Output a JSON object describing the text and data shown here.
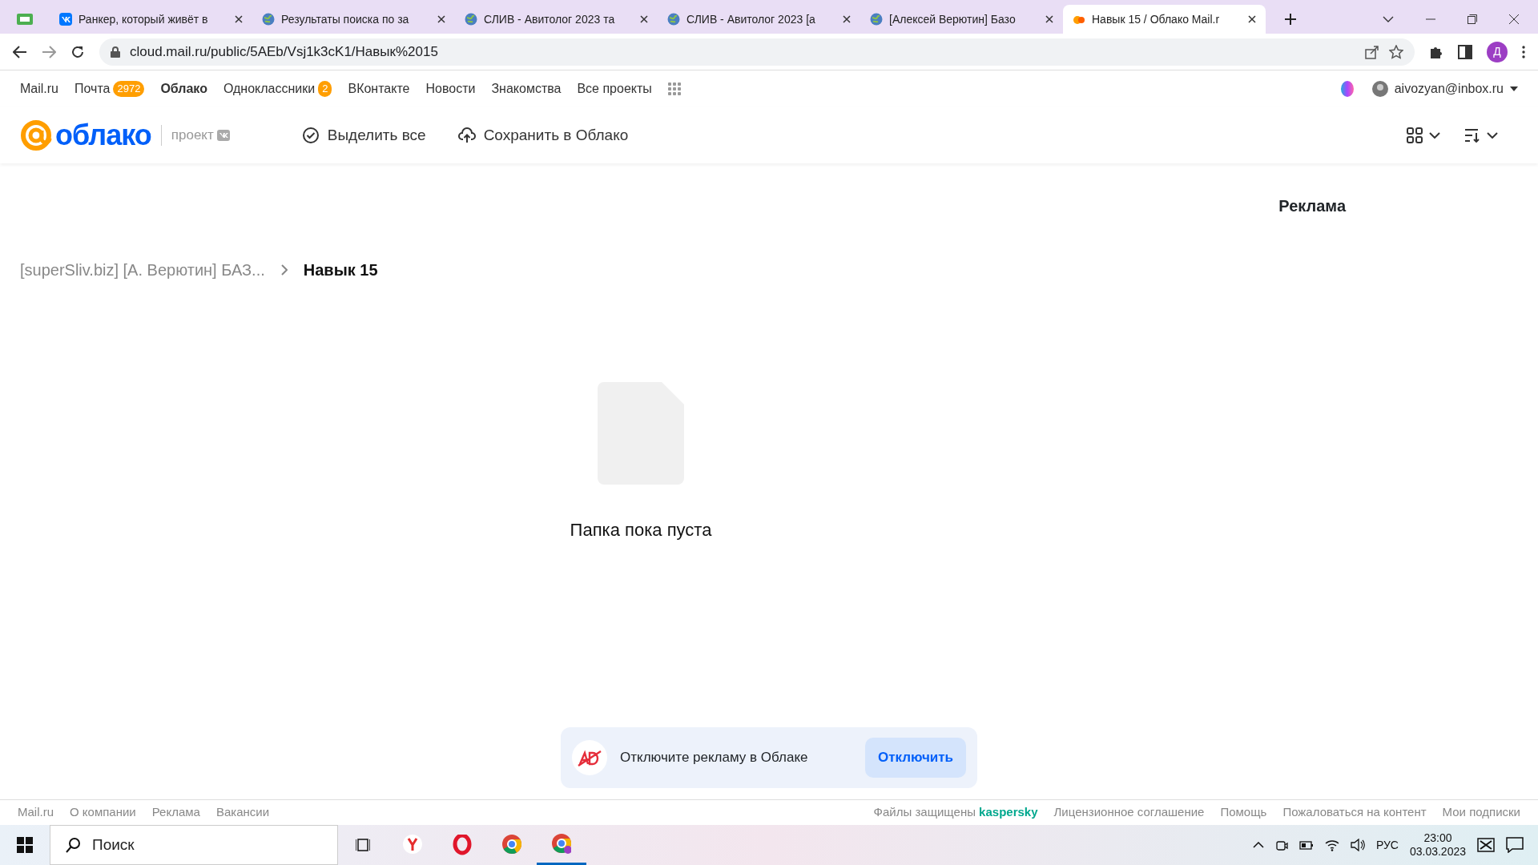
{
  "browser": {
    "tabs": [
      {
        "title": "Ранкер, который живёт в",
        "kind": "vk",
        "selected": false
      },
      {
        "title": "Результаты поиска по за",
        "kind": "globe",
        "selected": false
      },
      {
        "title": "СЛИВ - Авитолог 2023 та",
        "kind": "globe",
        "selected": false
      },
      {
        "title": "СЛИВ - Авитолог 2023 [а",
        "kind": "globe",
        "selected": false
      },
      {
        "title": "[Алексей Верютин] Базо",
        "kind": "globe",
        "selected": false
      },
      {
        "title": "Навык 15 / Облако Mail.r",
        "kind": "cloud",
        "selected": true
      }
    ],
    "url": "cloud.mail.ru/public/5AEb/Vsj1k3cK1/Навык%2015",
    "profile": "Д"
  },
  "top_nav": {
    "items": [
      {
        "label": "Mail.ru",
        "selected": false
      },
      {
        "label": "Почта",
        "badge": "2972",
        "selected": false
      },
      {
        "label": "Облако",
        "selected": true
      },
      {
        "label": "Одноклассники",
        "badge": "2",
        "selected": false
      },
      {
        "label": "ВКонтакте",
        "selected": false
      },
      {
        "label": "Новости",
        "selected": false
      },
      {
        "label": "Знакомства",
        "selected": false
      },
      {
        "label": "Все проекты",
        "selected": false
      }
    ],
    "user": "aivozyan@inbox.ru"
  },
  "header": {
    "logo": "облако",
    "project": "проект",
    "actions": [
      "Выделить все",
      "Сохранить в Облако"
    ],
    "view_menu": {
      "expanded": false
    },
    "sort_menu": {
      "expanded": false
    }
  },
  "ad_label": "Реклама",
  "breadcrumb": [
    "[superSliv.biz] [А. Верютин] БАЗ...",
    "Навык 15"
  ],
  "empty_text": "Папка пока пуста",
  "ad_banner": {
    "text": "Отключите рекламу в Облаке",
    "button": "Отключить"
  },
  "footer": {
    "links": [
      "Mail.ru",
      "О компании",
      "Реклама",
      "Вакансии"
    ],
    "protected": "Файлы защищены",
    "brand": "kaspersky",
    "right_links": [
      "Лицензионное соглашение",
      "Помощь",
      "Пожаловаться на контент",
      "Мои подписки"
    ]
  },
  "taskbar": {
    "search": "Поиск",
    "language": "РУС",
    "time": "23:00",
    "date": "03.03.2023"
  }
}
